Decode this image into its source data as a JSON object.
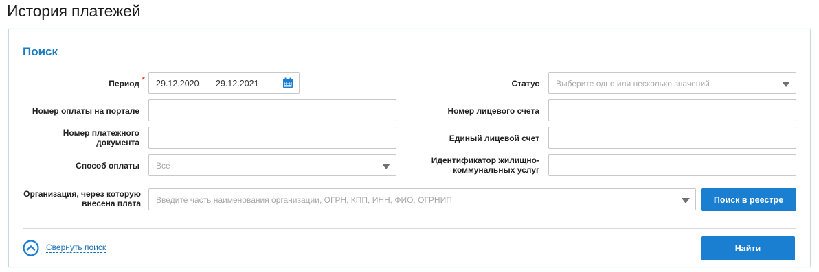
{
  "page": {
    "title": "История платежей"
  },
  "search": {
    "title": "Поиск",
    "period": {
      "label": "Период",
      "from": "29.12.2020",
      "separator": "-",
      "to": "29.12.2021"
    },
    "status": {
      "label": "Статус",
      "placeholder": "Выберите одно или несколько значений"
    },
    "portal_payment_number": {
      "label": "Номер оплаты на портале",
      "value": ""
    },
    "personal_account_number": {
      "label": "Номер лицевого счета",
      "value": ""
    },
    "payment_document_number": {
      "label_line1": "Номер платежного",
      "label_line2": "документа",
      "value": ""
    },
    "unified_personal_account": {
      "label": "Единый лицевой счет",
      "value": ""
    },
    "payment_method": {
      "label": "Способ оплаты",
      "selected": "Все"
    },
    "housing_service_id": {
      "label_line1": "Идентификатор жилищно-",
      "label_line2": "коммунальных услуг",
      "value": ""
    },
    "organization": {
      "label_line1": "Организация, через которую",
      "label_line2": "внесена плата",
      "placeholder": "Введите часть наименования организации, ОГРН, КПП, ИНН, ФИО, ОГРНИП"
    },
    "registry_search_label": "Поиск в реестре",
    "collapse_label": "Свернуть поиск",
    "find_label": "Найти"
  },
  "colors": {
    "accent": "#1a7fd1",
    "title_blue": "#1c7cbf",
    "required": "#d9261c"
  }
}
